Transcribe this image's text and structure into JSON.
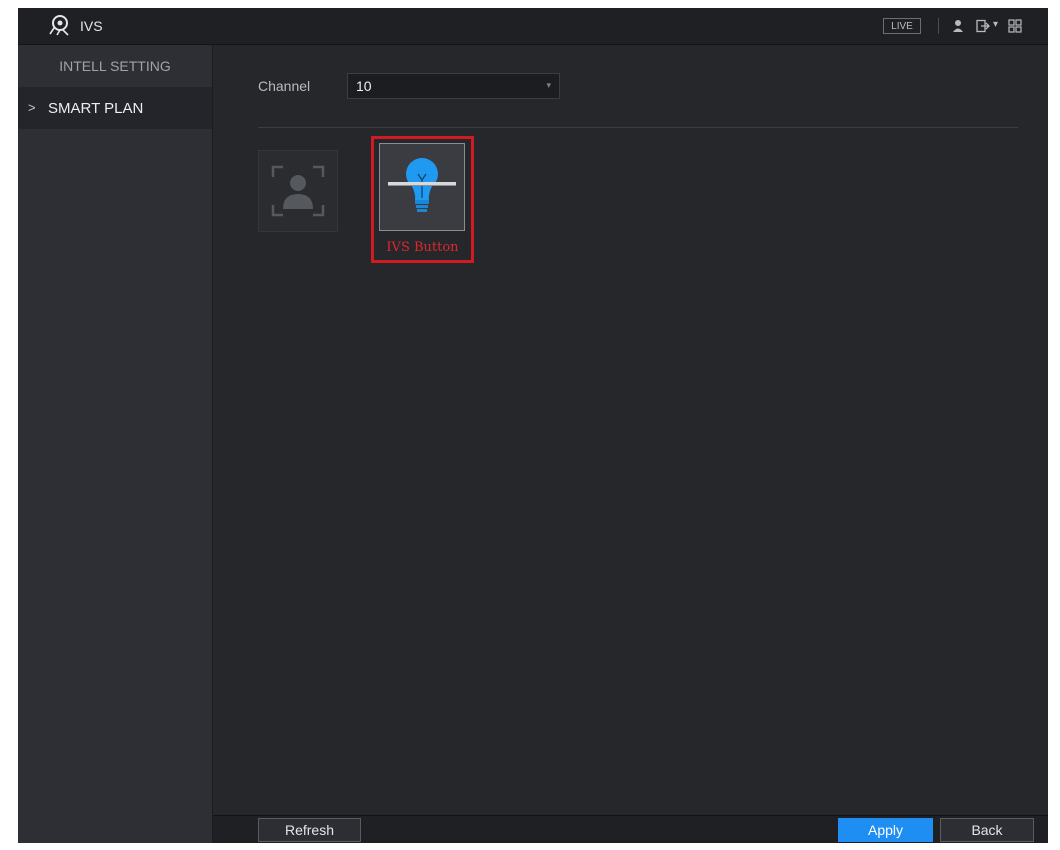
{
  "app": {
    "title": "IVS"
  },
  "topbar": {
    "live_label": "LIVE",
    "menu_caret": "▾"
  },
  "sidebar": {
    "section_title": "INTELL SETTING",
    "items": [
      {
        "label": "SMART PLAN",
        "chevron": ">",
        "selected": true
      }
    ]
  },
  "channel": {
    "label": "Channel",
    "value": "10",
    "caret": "▾"
  },
  "plans": {
    "tiles": [
      {
        "icon": "face-detection-icon",
        "state": "disabled"
      },
      {
        "icon": "ivs-bulb-icon",
        "state": "selected",
        "annotation": "IVS Button"
      }
    ]
  },
  "colors": {
    "accent": "#1e8ef2",
    "highlight": "#d11b22",
    "bulb": "#1f9af0"
  },
  "buttons": {
    "refresh": "Refresh",
    "apply": "Apply",
    "back": "Back"
  }
}
